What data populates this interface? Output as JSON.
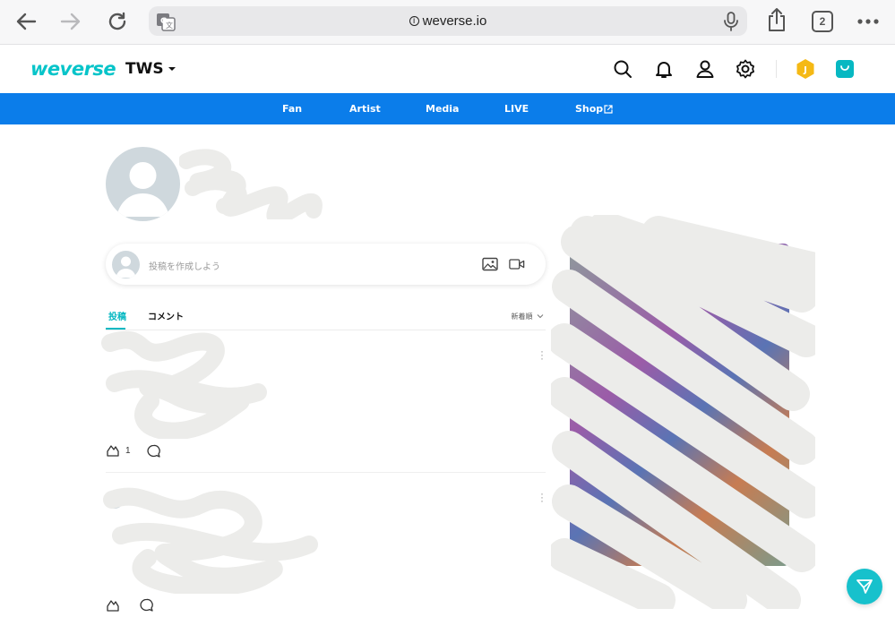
{
  "browser": {
    "url": "weverse.io",
    "tab_count": "2"
  },
  "header": {
    "logo_text": "weverse",
    "community_name": "TWS",
    "jelly_label": "J"
  },
  "nav": {
    "items": [
      {
        "label": "Fan"
      },
      {
        "label": "Artist"
      },
      {
        "label": "Media"
      },
      {
        "label": "LIVE"
      },
      {
        "label": "Shop"
      }
    ]
  },
  "composer": {
    "placeholder": "投稿を作成しよう"
  },
  "feed_tabs": {
    "posts_label": "投稿",
    "comments_label": "コメント",
    "sort_label": "新着順"
  },
  "posts": [
    {
      "reaction_count": "1"
    },
    {
      "reaction_count": ""
    }
  ],
  "colors": {
    "brand": "#07c4c9",
    "nav_blue": "#0b7dea",
    "fab": "#17c1cc"
  }
}
